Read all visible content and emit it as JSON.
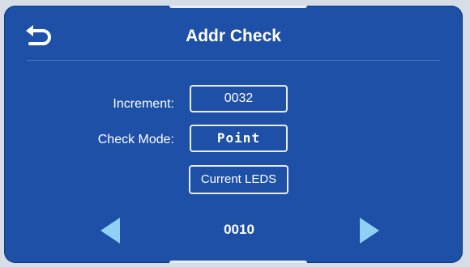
{
  "header": {
    "title": "Addr Check",
    "back_icon": "back-arrow-icon"
  },
  "settings": {
    "increment_label": "Increment:",
    "increment_value": "0032",
    "check_mode_label": "Check Mode:",
    "check_mode_value": "Point",
    "current_leds_label": "Current LEDS"
  },
  "navigation": {
    "prev_icon": "triangle-left-icon",
    "next_icon": "triangle-right-icon",
    "current_value": "0010"
  },
  "colors": {
    "panel_background": "#1d50a6",
    "page_background": "#d7dde6",
    "text": "#ffffff",
    "arrow": "#8fd0f5"
  }
}
